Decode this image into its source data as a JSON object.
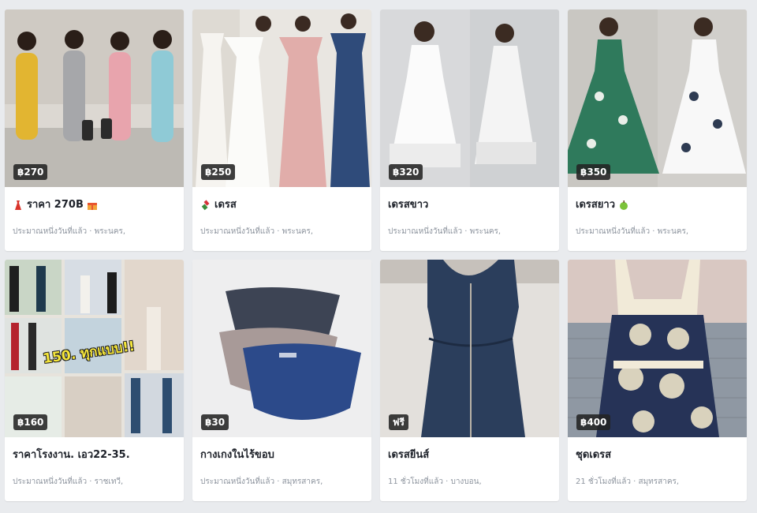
{
  "listings": [
    {
      "price": "฿270",
      "title": "ราคา 270B",
      "title_icon_left": "dress-icon",
      "title_icon_right": "gift-icon",
      "meta": "ประมาณหนึ่งวันที่แล้ว · พระนคร,",
      "image": "women-jumpsuits-photo"
    },
    {
      "price": "฿250",
      "title": "เดรส",
      "title_icon_left": "lipstick-icon",
      "meta": "ประมาณหนึ่งวันที่แล้ว · พระนคร,",
      "image": "off-shoulder-dresses-photo"
    },
    {
      "price": "฿320",
      "title": "เดรสขาว",
      "meta": "ประมาณหนึ่งวันที่แล้ว · พระนคร,",
      "image": "white-lace-dress-photo"
    },
    {
      "price": "฿350",
      "title": "เดรสยาว",
      "title_icon_right": "green-apple-icon",
      "meta": "ประมาณหนึ่งวันที่แล้ว · พระนคร,",
      "image": "floral-dresses-photo"
    },
    {
      "price": "฿160",
      "title": "ราคาโรงงาน. เอว22-35.",
      "meta": "ประมาณหนึ่งวันที่แล้ว · ราชเทวี,",
      "image": "pants-collage-photo",
      "image_text": "150. ทุกแบบ!!"
    },
    {
      "price": "฿30",
      "title": "กางเกงในไร้ขอบ",
      "meta": "ประมาณหนึ่งวันที่แล้ว · สมุทรสาคร,",
      "image": "seamless-underwear-photo"
    },
    {
      "price": "ฟรี",
      "title": "เดรสยีนส์",
      "meta": "11 ชั่วโมงที่แล้ว · บางบอน,",
      "image": "denim-dress-photo"
    },
    {
      "price": "฿400",
      "title": "ชุดเดรส",
      "meta": "21 ชั่วโมงที่แล้ว · สมุทรสาคร,",
      "image": "patterned-dress-photo"
    }
  ],
  "colors": {
    "background": "#e9ebee",
    "card": "#ffffff",
    "title": "#1d2129",
    "meta": "#8d949e",
    "price_badge": "#232323"
  }
}
